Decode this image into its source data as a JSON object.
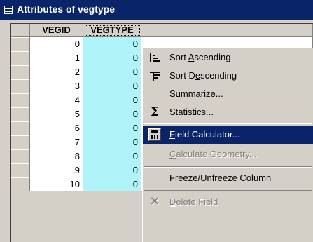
{
  "window": {
    "title": "Attributes of vegtype",
    "icon": "table-icon"
  },
  "table": {
    "columns": [
      "VEGID",
      "VEGTYPE"
    ],
    "rows": [
      {
        "vegid": "0",
        "vegtype": "0"
      },
      {
        "vegid": "1",
        "vegtype": "0"
      },
      {
        "vegid": "2",
        "vegtype": "0"
      },
      {
        "vegid": "3",
        "vegtype": "0"
      },
      {
        "vegid": "4",
        "vegtype": "0"
      },
      {
        "vegid": "5",
        "vegtype": "0"
      },
      {
        "vegid": "6",
        "vegtype": "0"
      },
      {
        "vegid": "7",
        "vegtype": "0"
      },
      {
        "vegid": "8",
        "vegtype": "0"
      },
      {
        "vegid": "9",
        "vegtype": "0"
      },
      {
        "vegid": "10",
        "vegtype": "0"
      }
    ],
    "selected_column": "VEGTYPE",
    "selected_column_color": "#aef4f8"
  },
  "context_menu": {
    "items": [
      {
        "id": "sort-ascending",
        "pre": "Sort ",
        "key": "A",
        "post": "scending",
        "icon": "sort-ascending-icon",
        "enabled": true
      },
      {
        "id": "sort-descending",
        "pre": "Sort D",
        "key": "e",
        "post": "scending",
        "icon": "sort-descending-icon",
        "enabled": true
      },
      {
        "id": "summarize",
        "pre": "",
        "key": "S",
        "post": "ummarize...",
        "icon": "",
        "enabled": true
      },
      {
        "id": "statistics",
        "pre": "S",
        "key": "t",
        "post": "atistics...",
        "icon": "sigma-icon",
        "enabled": true
      },
      {
        "id": "field-calculator",
        "pre": "",
        "key": "F",
        "post": "ield Calculator...",
        "icon": "calculator-icon",
        "enabled": true,
        "highlighted": true
      },
      {
        "id": "calculate-geometry",
        "pre": "",
        "key": "C",
        "post": "alculate Geometry...",
        "icon": "",
        "enabled": false
      },
      {
        "id": "freeze-unfreeze",
        "pre": "Free",
        "key": "z",
        "post": "e/Unfreeze Column",
        "icon": "",
        "enabled": true
      },
      {
        "id": "delete-field",
        "pre": "",
        "key": "D",
        "post": "elete Field",
        "icon": "delete-x-icon",
        "enabled": false
      }
    ],
    "highlight_color": "#0a246a"
  }
}
